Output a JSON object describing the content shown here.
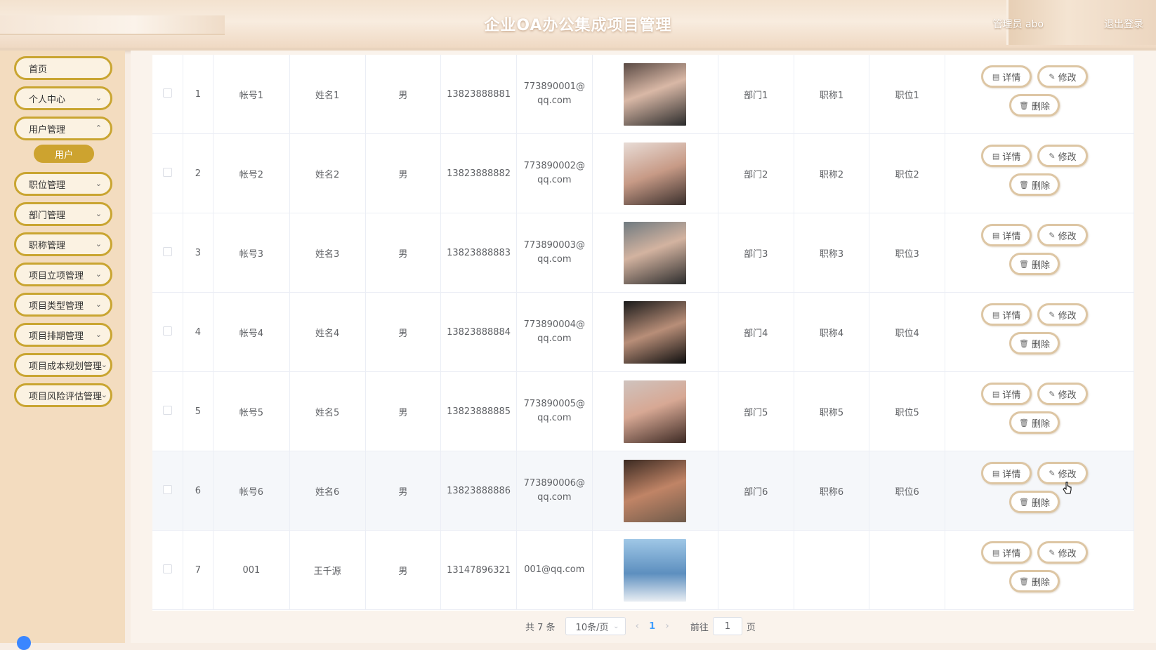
{
  "header": {
    "title": "企业OA办公集成项目管理",
    "user": "管理员 abo",
    "logout": "退出登录"
  },
  "sidebar": {
    "items": [
      {
        "label": "首页"
      },
      {
        "label": "个人中心"
      },
      {
        "label": "用户管理"
      },
      {
        "label": "用户"
      },
      {
        "label": "职位管理"
      },
      {
        "label": "部门管理"
      },
      {
        "label": "职称管理"
      },
      {
        "label": "项目立项管理"
      },
      {
        "label": "项目类型管理"
      },
      {
        "label": "项目排期管理"
      },
      {
        "label": "项目成本规划管理"
      },
      {
        "label": "项目风险评估管理"
      }
    ]
  },
  "actions": {
    "detail": "详情",
    "edit": "修改",
    "delete": "删除"
  },
  "table": {
    "rows": [
      {
        "index": "1",
        "account": "帐号1",
        "name": "姓名1",
        "gender": "男",
        "phone": "13823888881",
        "email": "773890001@qq.com",
        "dept": "部门1",
        "title": "职称1",
        "position": "职位1"
      },
      {
        "index": "2",
        "account": "帐号2",
        "name": "姓名2",
        "gender": "男",
        "phone": "13823888882",
        "email": "773890002@qq.com",
        "dept": "部门2",
        "title": "职称2",
        "position": "职位2"
      },
      {
        "index": "3",
        "account": "帐号3",
        "name": "姓名3",
        "gender": "男",
        "phone": "13823888883",
        "email": "773890003@qq.com",
        "dept": "部门3",
        "title": "职称3",
        "position": "职位3"
      },
      {
        "index": "4",
        "account": "帐号4",
        "name": "姓名4",
        "gender": "男",
        "phone": "13823888884",
        "email": "773890004@qq.com",
        "dept": "部门4",
        "title": "职称4",
        "position": "职位4"
      },
      {
        "index": "5",
        "account": "帐号5",
        "name": "姓名5",
        "gender": "男",
        "phone": "13823888885",
        "email": "773890005@qq.com",
        "dept": "部门5",
        "title": "职称5",
        "position": "职位5"
      },
      {
        "index": "6",
        "account": "帐号6",
        "name": "姓名6",
        "gender": "男",
        "phone": "13823888886",
        "email": "773890006@qq.com",
        "dept": "部门6",
        "title": "职称6",
        "position": "职位6"
      },
      {
        "index": "7",
        "account": "001",
        "name": "王千源",
        "gender": "男",
        "phone": "13147896321",
        "email": "001@qq.com",
        "dept": "",
        "title": "",
        "position": ""
      }
    ]
  },
  "pagination": {
    "total": "共 7 条",
    "page_size": "10条/页",
    "current_page": "1",
    "goto_prefix": "前往",
    "goto_value": "1",
    "goto_suffix": "页"
  },
  "colors": {
    "accent": "#cda32f",
    "menu_border": "#c9a531",
    "button_border": "#ddc6a4",
    "active_page": "#409eff"
  }
}
